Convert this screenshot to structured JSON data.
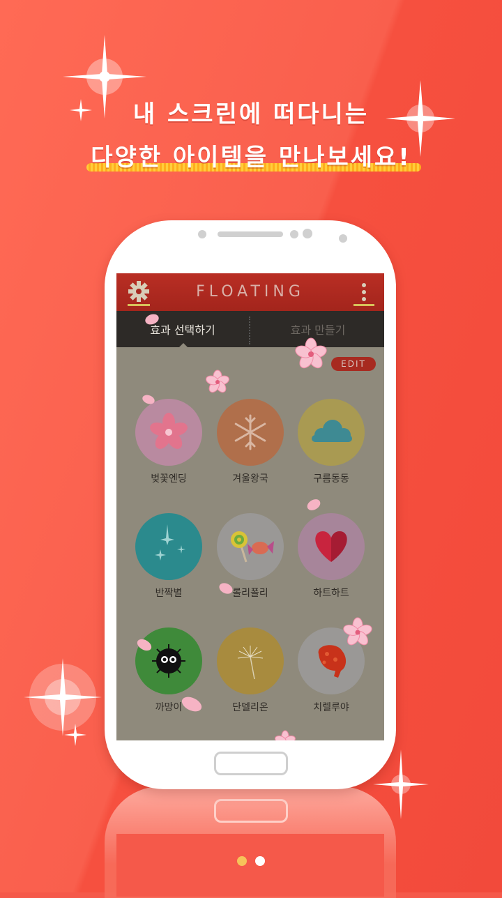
{
  "headline": {
    "line1": "내 스크린에 떠다니는",
    "line2": "다양한 아이템을 만나보세요!"
  },
  "app": {
    "title": "FLOATING",
    "icons": {
      "settings": "gear-icon",
      "menu": "vertical-dots-icon"
    },
    "accent_color": "#a72a20",
    "tabs": [
      {
        "label": "효과 선택하기",
        "active": true
      },
      {
        "label": "효과 만들기",
        "active": false
      }
    ],
    "edit_label": "EDIT",
    "effects": [
      {
        "label": "벚꽃엔딩",
        "icon": "cherry-blossom-icon",
        "color": "#b98aa0"
      },
      {
        "label": "겨울왕국",
        "icon": "snowflake-icon",
        "color": "#b06f4b"
      },
      {
        "label": "구름동동",
        "icon": "cloud-icon",
        "color": "#a99a52"
      },
      {
        "label": "반짝별",
        "icon": "sparkle-icon",
        "color": "#2b8a8d"
      },
      {
        "label": "롤리폴리",
        "icon": "candy-icon",
        "color": "#9a9896"
      },
      {
        "label": "하트하트",
        "icon": "heart-icon",
        "color": "#a7859a"
      },
      {
        "label": "까망이",
        "icon": "soot-sprite-icon",
        "color": "#3f8a3a"
      },
      {
        "label": "단델리온",
        "icon": "dandelion-icon",
        "color": "#a88b3e"
      },
      {
        "label": "치렐루야",
        "icon": "fried-chicken-icon",
        "color": "#9a9896"
      }
    ]
  },
  "pager": {
    "active_index": 0,
    "count": 2,
    "active_color": "#f6c35a"
  }
}
